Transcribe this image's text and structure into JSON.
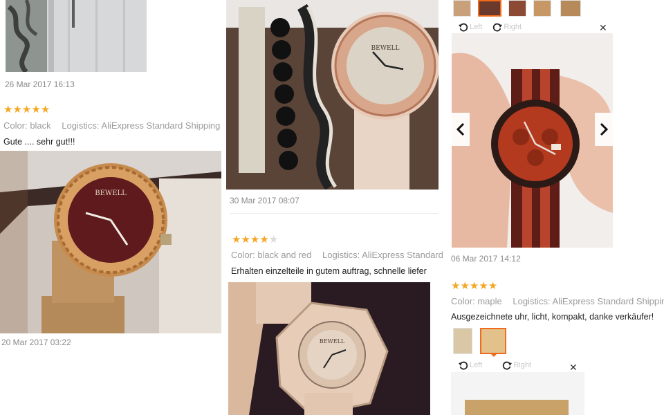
{
  "reviews": [
    {
      "date": "26 Mar 2017 16:13"
    },
    {
      "rating": 5,
      "color_label": "Color:",
      "color_value": "black",
      "logistics_label": "Logistics:",
      "logistics_value": "AliExpress Standard Shipping",
      "text": "Gute .... sehr gut!!!",
      "date": "20 Mar 2017 03:22"
    },
    {
      "date": "30 Mar 2017 08:07"
    },
    {
      "rating": 4,
      "color_label": "Color:",
      "color_value": "black and red",
      "logistics_label": "Logistics:",
      "logistics_value": "AliExpress Standard",
      "text": "Erhalten einzelteile in gutem auftrag, schnelle liefer"
    },
    {
      "date": "06 Mar 2017 14:12",
      "viewer": {
        "rotate_left": "Left",
        "rotate_right": "Right"
      }
    },
    {
      "rating": 5,
      "color_label": "Color:",
      "color_value": "maple",
      "logistics_label": "Logistics:",
      "logistics_value": "AliExpress Standard Shipping",
      "text": "Ausgezeichnete uhr, licht, kompakt, danke verkäufer!",
      "viewer": {
        "rotate_left": "Left",
        "rotate_right": "Right"
      }
    }
  ],
  "colors": {
    "star": "#f5a623",
    "active_thumb_border": "#f26b1d",
    "muted_text": "#9b9b9b"
  }
}
